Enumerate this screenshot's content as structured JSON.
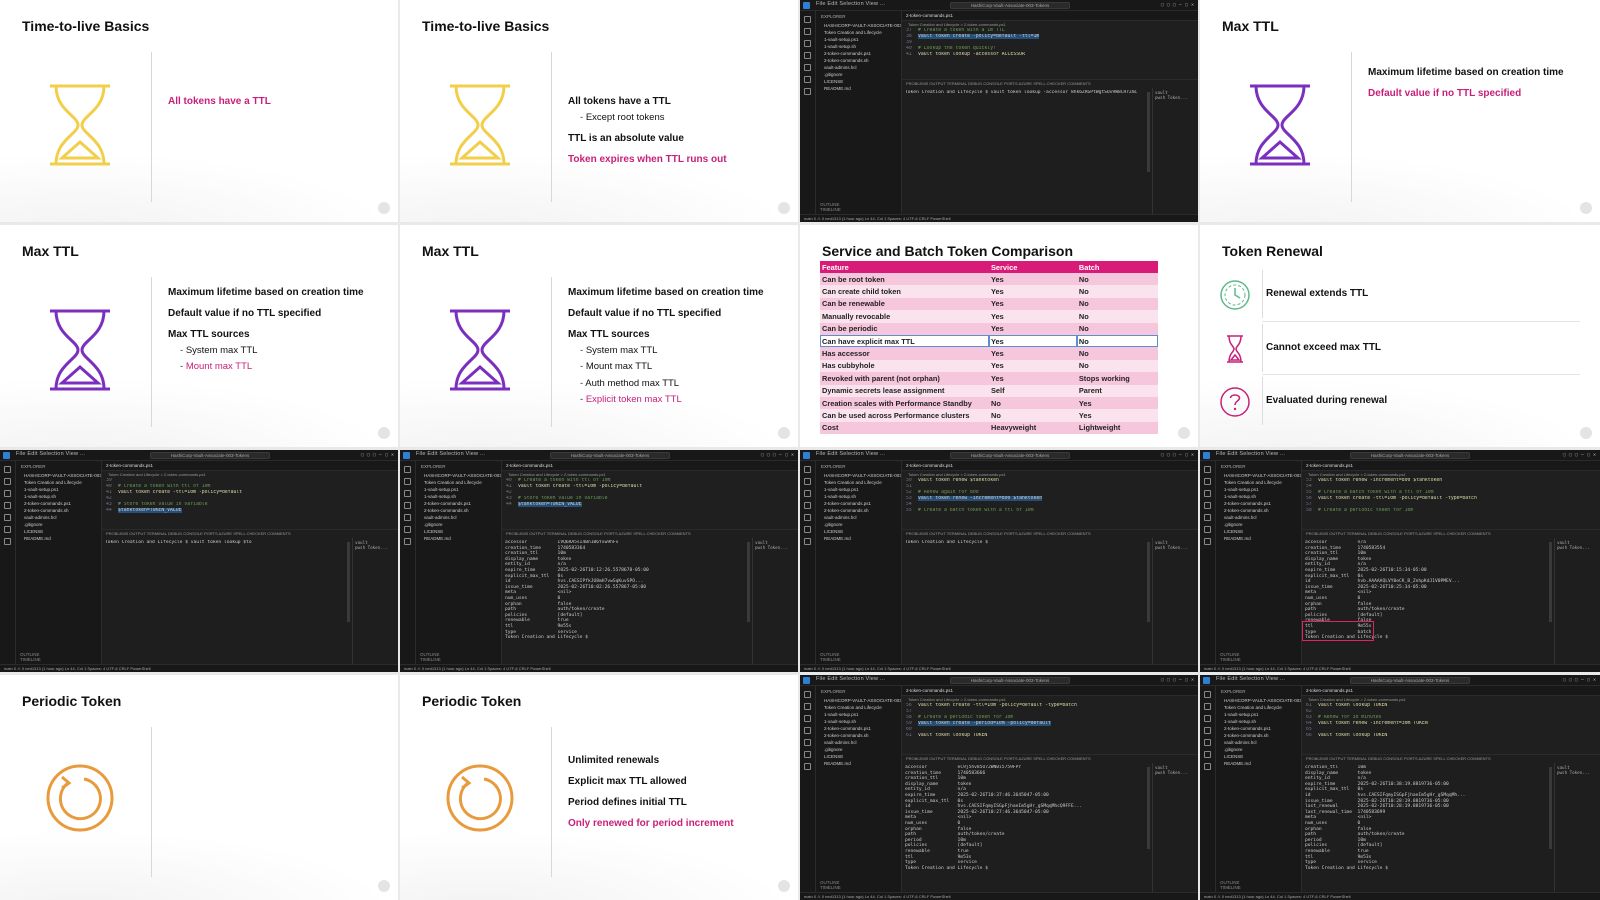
{
  "slides": {
    "ttl1": {
      "title": "Time-to-live Basics",
      "bullets": [
        "All tokens have a TTL"
      ]
    },
    "ttl2": {
      "title": "Time-to-live Basics",
      "b1": "All tokens have a TTL",
      "s1": "Except root tokens",
      "b2": "TTL is an absolute value",
      "b3": "Token expires when TTL runs out"
    },
    "max1": {
      "title": "Max TTL",
      "b1": "Maximum lifetime based on creation time",
      "b2": "Default value if no TTL specified"
    },
    "max2": {
      "title": "Max TTL",
      "b1": "Maximum lifetime based on creation time",
      "b2": "Default value if no TTL specified",
      "b3": "Max TTL sources",
      "s1": "System max TTL",
      "s2": "Mount max TTL"
    },
    "max3": {
      "title": "Max TTL",
      "b1": "Maximum lifetime based on creation time",
      "b2": "Default value if no TTL specified",
      "b3": "Max TTL sources",
      "s1": "System max TTL",
      "s2": "Mount max TTL",
      "s3": "Auth method max TTL",
      "s4": "Explicit token max TTL"
    },
    "renew": {
      "title": "Token Renewal",
      "items": [
        "Renewal extends TTL",
        "Cannot exceed max TTL",
        "Evaluated during renewal"
      ]
    },
    "per1": {
      "title": "Periodic Token"
    },
    "per2": {
      "title": "Periodic Token",
      "b1": "Unlimited renewals",
      "b2": "Explicit max TTL allowed",
      "b3": "Period defines initial TTL",
      "b4": "Only renewed for period increment"
    }
  },
  "comparison": {
    "title": "Service and Batch Token Comparison",
    "headers": [
      "Feature",
      "Service",
      "Batch"
    ],
    "rows": [
      [
        "Can be root token",
        "Yes",
        "No"
      ],
      [
        "Can create child token",
        "Yes",
        "No"
      ],
      [
        "Can be renewable",
        "Yes",
        "No"
      ],
      [
        "Manually revocable",
        "Yes",
        "No"
      ],
      [
        "Can be periodic",
        "Yes",
        "No"
      ],
      [
        "Can have explicit max TTL",
        "Yes",
        "No"
      ],
      [
        "Has accessor",
        "Yes",
        "No"
      ],
      [
        "Has cubbyhole",
        "Yes",
        "No"
      ],
      [
        "Revoked with parent (not orphan)",
        "Yes",
        "Stops working"
      ],
      [
        "Dynamic secrets lease assignment",
        "Self",
        "Parent"
      ],
      [
        "Creation scales with Performance Standby",
        "No",
        "Yes"
      ],
      [
        "Can be used across Performance clusters",
        "No",
        "Yes"
      ],
      [
        "Cost",
        "Heavyweight",
        "Lightweight"
      ]
    ]
  },
  "ide": {
    "menu": "File  Edit  Selection  View  ...",
    "search": "HashiCorp-Vault-Associate-003-Tokens",
    "explorer": "EXPLORER",
    "folder": "HASHICORP-VAULT-ASSOCIATE-003-TOK...",
    "files": [
      "Token Creation and Lifecycle",
      "1-vault-setup.ps1",
      "1-vault-setup.sh",
      "2-token-commands.ps1",
      "2-token-commands.sh",
      "vault-admins.hcl",
      ".gitignore",
      "LICENSE",
      "README.md"
    ],
    "outline": "OUTLINE",
    "timeline": "TIMELINE",
    "tab": "2-token-commands.ps1",
    "breadcrumb": "Token Creation and Lifecycle > 2-token-commands.ps1",
    "panel_tabs": "PROBLEMS   OUTPUT   TERMINAL   DEBUG CONSOLE   PORTS   AZURE   SPELL CHECKER   COMMENTS",
    "term_list": [
      "vault",
      "pwsh Token..."
    ],
    "status": "main   0 ⚠ 0   ned1313 (1 hour ago)   Ln 44, Col 1   Spaces: 4   UTF-8   CRLF   PowerShell",
    "s1": {
      "code": [
        [
          "37",
          "# Create a token with a 1m TTL",
          "cm"
        ],
        [
          "38",
          "vault token create -policy=default -ttl=1m",
          "sel"
        ],
        [
          "39",
          "",
          ""
        ],
        [
          "40",
          "# Lookup the token quickly!",
          "cm"
        ],
        [
          "41",
          "vault token lookup -accessor ACCESSOR",
          "kw"
        ]
      ],
      "term": "Token Creation and Lifecycle $ vault token lookup -accessor 8hk6ZRGPtWgtSUv9W8CRrZmC"
    },
    "s2": {
      "code": [
        [
          "39",
          "",
          ""
        ],
        [
          "40",
          "# Create a token with ttl of 10m",
          "cm"
        ],
        [
          "41",
          "vault token create -ttl=10m -policy=default",
          "kw"
        ],
        [
          "42",
          "",
          ""
        ],
        [
          "43",
          "# Store token value in variable",
          "cm"
        ],
        [
          "44",
          "$tanktoken=TOKEN_VALUE",
          "sel"
        ]
      ],
      "term": "Token Creation and Lifecycle $ vault token lookup $to"
    },
    "s3": {
      "code": [
        [
          "40",
          "# Create a token with ttl of 10m",
          "cm"
        ],
        [
          "41",
          "vault token create -ttl=10m -policy=default",
          "kw"
        ],
        [
          "42",
          "",
          ""
        ],
        [
          "43",
          "# Store token value in variable",
          "cm"
        ],
        [
          "44",
          "$tanktoken=TOKEN_VALUE",
          "sel"
        ]
      ],
      "term": "accessor           IVQ6RA5sI4Bn1B6Yxw9hFx\ncreation_time      1740583364\ncreation_ttl       10m\ndisplay_name       token\nentity_id          n/a\nexpire_time        2025-02-26T10:12:26.5578678-05:00\nexplicit_max_ttl   0s\nid                 hvs.CAESIPfkJU8mH7vwSqKuvSPO...\nissue_time         2025-02-26T10:02:26.557867-05:00\nmeta               <nil>\nnum_uses           0\norphan             false\npath               auth/token/create\npolicies           [default]\nrenewable          true\nttl                9m55s\ntype               service\nToken Creation and Lifecycle $"
    },
    "s4": {
      "code": [
        [
          "50",
          "vault token renew $tanktoken",
          "kw"
        ],
        [
          "51",
          "",
          ""
        ],
        [
          "52",
          "# Renew again for 800",
          "cm"
        ],
        [
          "53",
          "vault token renew -increment=800 $tanktoken",
          "sel"
        ],
        [
          "54",
          "",
          ""
        ],
        [
          "55",
          "# Create a batch token with a ttl of 10m",
          "cm"
        ]
      ],
      "term": "Token Creation and Lifecycle $ "
    },
    "s5": {
      "code": [
        [
          "53",
          "vault token renew -increment=800 $tanktoken",
          "kw"
        ],
        [
          "54",
          "",
          ""
        ],
        [
          "55",
          "# Create a batch token with a ttl of 10m",
          "cm"
        ],
        [
          "56",
          "vault token create -ttl=10m -policy=default -type=batch",
          "kw"
        ],
        [
          "57",
          "",
          ""
        ],
        [
          "58",
          "# Create a periodic token for 10m",
          "cm"
        ]
      ],
      "term": "accessor           n/a\ncreation_time      1740583554\ncreation_ttl       10m\ndisplay_name       token\nentity_id          n/a\nexpire_time        2025-02-26T10:15:34-05:00\nexplicit_max_ttl   0s\nid                 hvb.AAAAAQLVY0eCK_B_ZnhpKdJ1V0PMEV...\nissue_time         2025-02-26T10:25:34-05:00\nmeta               <nil>\nnum_uses           0\norphan             false\npath               auth/token/create\npolicies           [default]\nrenewable          false\nttl                9m55s\ntype               batch\nToken Creation and Lifecycle $"
    },
    "s6": {
      "code": [
        [
          "56",
          "vault token create -ttl=10m -policy=default -type=batch",
          "kw"
        ],
        [
          "57",
          "",
          ""
        ],
        [
          "58",
          "# Create a periodic token for 10m",
          "cm"
        ],
        [
          "59",
          "vault token create -period=10m -policy=default",
          "sel"
        ],
        [
          "60",
          "",
          ""
        ],
        [
          "61",
          "vault token lookup TOKEN",
          "kw"
        ]
      ],
      "term": "accessor           eC9j5hv85O72WN0i5759FPr\ncreation_time      1740583666\ncreation_ttl       10m\ndisplay_name       token\nentity_id          n/a\nexpire_time        2025-02-26T10:37:46.3645047-05:00\nexplicit_max_ttl   0s\nid                 hvs.CAESIFqmyISGpFjhaeIm5gHr_gSMqqMhcQ9FFE...\nissue_time         2025-02-26T10:27:46.3645047-05:00\nmeta               <nil>\nnum_uses           0\norphan             false\npath               auth/token/create\nperiod             10m\npolicies           [default]\nrenewable          true\nttl                9m53s\ntype               service\nToken Creation and Lifecycle $"
    },
    "s7": {
      "code": [
        [
          "61",
          "vault token lookup TOKEN",
          "kw"
        ],
        [
          "62",
          "",
          ""
        ],
        [
          "63",
          "# Renew for 30 minutes",
          "cm"
        ],
        [
          "64",
          "vault token renew -increment=30m TOKEN",
          "kw"
        ],
        [
          "65",
          "",
          ""
        ],
        [
          "66",
          "vault token lookup TOKEN",
          "kw"
        ]
      ],
      "term": "creation_ttl       10m\ndisplay_name       token\nentity_id          n/a\nexpire_time        2025-02-26T10:38:19.8819736-05:00\nexplicit_max_ttl   0s\nid                 hvs.CAESIFqmyISGpFjhaeIm5gHr_gSMqqMh...\nissue_time         2025-02-26T10:28:19.8819736-05:00\nlast_renewal       2025-02-26T10:28:19.8819736-05:00\nlast_renewal_time  1740583699\nmeta               <nil>\nnum_uses           0\norphan             false\npath               auth/token/create\nperiod             10m\npolicies           [default]\nrenewable          true\nttl                9m53s\ntype               service\nToken Creation and Lifecycle $"
    }
  },
  "colors": {
    "accent": "#c8207a",
    "hourglass_yellow": "#f2cf4a",
    "hourglass_purple": "#7b2fbe",
    "periodic_orange": "#e89a3c",
    "table_header": "#d81b78"
  },
  "icons": [
    "hourglass-icon",
    "clock-arrows-icon",
    "question-circle-icon",
    "refresh-circle-icon"
  ]
}
